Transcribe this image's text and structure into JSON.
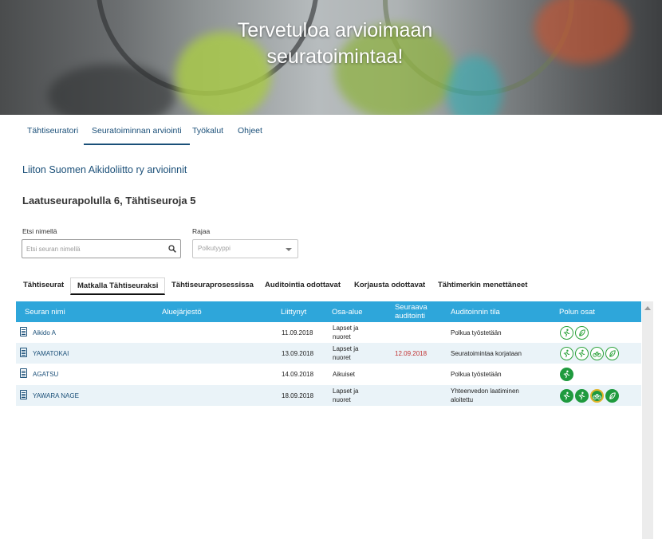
{
  "hero": {
    "title_line1": "Tervetuloa arvioimaan",
    "title_line2": "seuratoimintaa!"
  },
  "nav": {
    "items": [
      "Tähtiseuratori",
      "Seuratoiminnan arviointi",
      "Työkalut",
      "Ohjeet"
    ],
    "active": "Seuratoiminnan arviointi"
  },
  "org_title": "Liiton Suomen Aikidoliitto ry arvioinnit",
  "summary": "Laatuseurapolulla 6, Tähtiseuroja 5",
  "search": {
    "label": "Etsi nimellä",
    "placeholder": "Etsi seuran nimellä"
  },
  "filter": {
    "label": "Rajaa",
    "placeholder": "Polkutyyppi"
  },
  "tabs": [
    "Tähtiseurat",
    "Matkalla Tähtiseuraksi",
    "Tähtiseuraprosessissa",
    "Auditointia odottavat",
    "Korjausta odottavat",
    "Tähtimerkin menettäneet"
  ],
  "active_tab": "Matkalla Tähtiseuraksi",
  "table": {
    "headers": {
      "name": "Seuran nimi",
      "district": "Aluejärjestö",
      "joined": "Liittynyt",
      "area": "Osa-alue",
      "next_audit_1": "Seuraava",
      "next_audit_2": "auditointi",
      "status": "Auditoinnin tila",
      "parts": "Polun osat"
    },
    "rows": [
      {
        "name": "Aikido A",
        "joined": "11.09.2018",
        "area_1": "Lapset ja",
        "area_2": "nuoret",
        "next": "",
        "status_1": "Polkua työstetään",
        "status_2": "",
        "badges": [
          "outline",
          "outline"
        ]
      },
      {
        "name": "YAMATOKAI",
        "joined": "13.09.2018",
        "area_1": "Lapset ja",
        "area_2": "nuoret",
        "next": "12.09.2018",
        "status_1": "Seuratoimintaa korjataan",
        "status_2": "",
        "badges": [
          "outline",
          "outline",
          "outline",
          "outline"
        ]
      },
      {
        "name": "AGATSU",
        "joined": "14.09.2018",
        "area_1": "Aikuiset",
        "area_2": "",
        "next": "",
        "status_1": "Polkua työstetään",
        "status_2": "",
        "badges": [
          "filled"
        ]
      },
      {
        "name": "YAWARA NAGE",
        "joined": "18.09.2018",
        "area_1": "Lapset ja",
        "area_2": "nuoret",
        "next": "",
        "status_1": "Yhteenvedon laatiminen",
        "status_2": "aloitettu",
        "badges": [
          "filled",
          "filled",
          "yellow",
          "filled"
        ]
      }
    ]
  },
  "colors": {
    "header_blue": "#2ea6da",
    "link_blue": "#1a4f78",
    "badge_green": "#1f9a3e",
    "badge_yellow": "#e0b52a",
    "red": "#c03030"
  }
}
